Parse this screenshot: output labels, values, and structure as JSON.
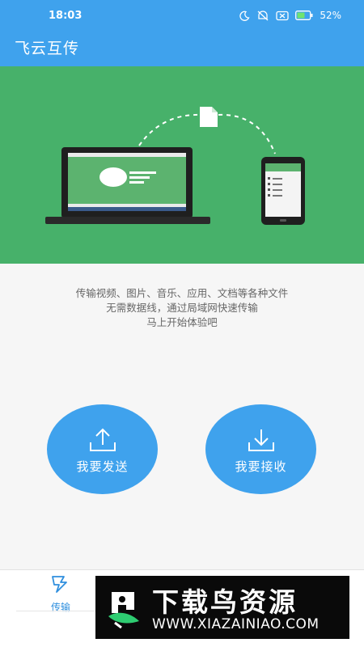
{
  "status_bar": {
    "time": "18:03",
    "battery_percent": "52%",
    "icons": [
      "moon-icon",
      "mute-icon",
      "sim-off-icon",
      "battery-icon"
    ]
  },
  "app_bar": {
    "title": "飞云互传"
  },
  "hero": {
    "illustration": [
      "laptop",
      "file-icon",
      "phone"
    ]
  },
  "description": {
    "line1": "传输视频、图片、音乐、应用、文档等各种文件",
    "line2": "无需数据线，通过局域网快速传输",
    "line3": "马上开始体验吧"
  },
  "actions": {
    "send_label": "我要发送",
    "receive_label": "我要接收"
  },
  "bottom_nav": {
    "tabs": [
      {
        "label": "传输",
        "icon": "transfer-icon",
        "active": true
      }
    ]
  },
  "watermark": {
    "title": "下载鸟资源",
    "url": "WWW.XIAZAINIAO.COM"
  },
  "colors": {
    "primary": "#3fa2ed",
    "hero_green": "#47b16a",
    "background": "#f6f6f6"
  }
}
